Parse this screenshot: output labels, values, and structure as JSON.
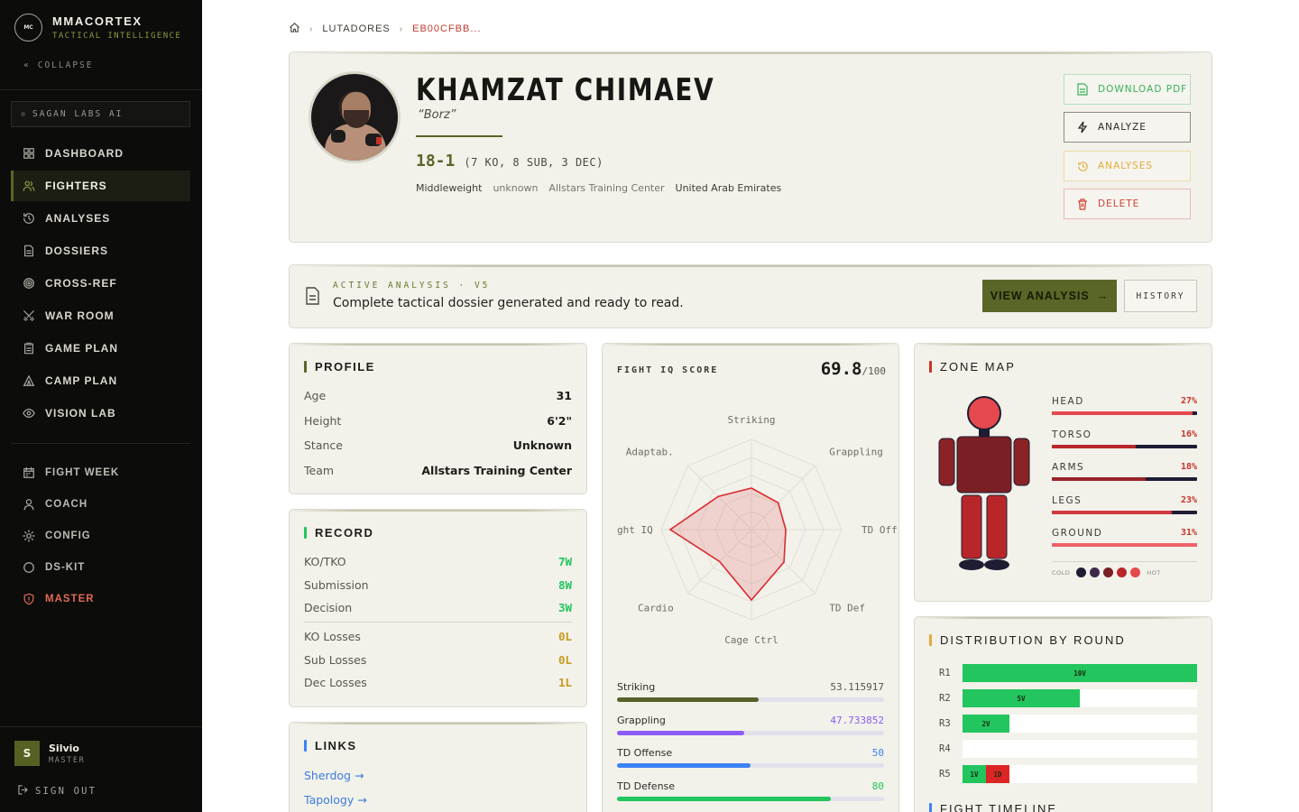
{
  "brand": {
    "logo": "MC",
    "name": "MMACORTEX",
    "tagline": "TACTICAL INTELLIGENCE",
    "collapse": "COLLAPSE"
  },
  "org": {
    "name": "SAGAN LABS AI"
  },
  "nav": [
    {
      "label": "DASHBOARD",
      "icon": "grid-icon"
    },
    {
      "label": "FIGHTERS",
      "icon": "users-icon",
      "active": true
    },
    {
      "label": "ANALYSES",
      "icon": "history-icon"
    },
    {
      "label": "DOSSIERS",
      "icon": "file-icon"
    },
    {
      "label": "CROSS-REF",
      "icon": "target-icon"
    },
    {
      "label": "WAR ROOM",
      "icon": "swords-icon"
    },
    {
      "label": "GAME PLAN",
      "icon": "clipboard-icon"
    },
    {
      "label": "CAMP PLAN",
      "icon": "tent-icon"
    },
    {
      "label": "VISION LAB",
      "icon": "eye-icon"
    }
  ],
  "nav2": [
    {
      "label": "FIGHT WEEK",
      "icon": "calendar-icon"
    },
    {
      "label": "COACH",
      "icon": "user-icon"
    },
    {
      "label": "CONFIG",
      "icon": "gear-icon"
    },
    {
      "label": "DS-KIT",
      "icon": "circle-icon"
    },
    {
      "label": "MASTER",
      "icon": "shield-icon"
    }
  ],
  "user": {
    "initial": "S",
    "name": "Silvio",
    "role": "MASTER",
    "signout": "SIGN OUT"
  },
  "breadcrumb": {
    "section": "LUTADORES",
    "current": "EB00CFBB..."
  },
  "fighter": {
    "name": "KHAMZAT CHIMAEV",
    "nickname": "“Borz”",
    "record": "18-1",
    "record_detail": "(7 KO, 8 SUB, 3 DEC)",
    "weight_class": "Middleweight",
    "extra": "unknown",
    "team": "Allstars Training Center",
    "country": "United Arab Emirates"
  },
  "actions": {
    "download": "DOWNLOAD PDF",
    "analyze": "ANALYZE",
    "analyses": "ANALYSES",
    "delete": "DELETE"
  },
  "analysis": {
    "label": "ACTIVE ANALYSIS · V5",
    "text": "Complete tactical dossier generated and ready to read.",
    "view": "VIEW ANALYSIS",
    "history": "HISTORY"
  },
  "profile": {
    "title": "PROFILE",
    "rows": [
      {
        "label": "Age",
        "value": "31"
      },
      {
        "label": "Height",
        "value": "6'2\""
      },
      {
        "label": "Stance",
        "value": "Unknown"
      },
      {
        "label": "Team",
        "value": "Allstars Training Center"
      }
    ]
  },
  "record_card": {
    "title": "RECORD",
    "wins": [
      {
        "label": "KO/TKO",
        "value": "7W"
      },
      {
        "label": "Submission",
        "value": "8W"
      },
      {
        "label": "Decision",
        "value": "3W"
      }
    ],
    "losses": [
      {
        "label": "KO Losses",
        "value": "0L"
      },
      {
        "label": "Sub Losses",
        "value": "0L"
      },
      {
        "label": "Dec Losses",
        "value": "1L"
      }
    ]
  },
  "links": {
    "title": "LINKS",
    "items": [
      "Sherdog →",
      "Tapology →"
    ]
  },
  "iq": {
    "title": "FIGHT IQ SCORE",
    "score": "69.8",
    "max": "/100",
    "axes": [
      "Striking",
      "Grappling",
      "TD Off",
      "TD Def",
      "Cage Ctrl",
      "Cardio",
      "ght IQ",
      "Adaptab."
    ],
    "radar_values": [
      0.46,
      0.42,
      0.38,
      0.51,
      0.78,
      0.5,
      0.9,
      0.52
    ],
    "bars": [
      {
        "label": "Striking",
        "value": "53.115917",
        "pct": 53.1,
        "color": "#57622a",
        "vcolor": "#55544d"
      },
      {
        "label": "Grappling",
        "value": "47.733852",
        "pct": 47.7,
        "color": "#8b5cf6",
        "vcolor": "#8b5cf6"
      },
      {
        "label": "TD Offense",
        "value": "50",
        "pct": 50,
        "color": "#3b82f6",
        "vcolor": "#3b82f6"
      },
      {
        "label": "TD Defense",
        "value": "80",
        "pct": 80,
        "color": "#22c55e",
        "vcolor": "#22c55e"
      }
    ]
  },
  "zone": {
    "title": "ZONE MAP",
    "rows": [
      {
        "label": "HEAD",
        "pct": "27%",
        "value": 27
      },
      {
        "label": "TORSO",
        "pct": "16%",
        "value": 16
      },
      {
        "label": "ARMS",
        "pct": "18%",
        "value": 18
      },
      {
        "label": "LEGS",
        "pct": "23%",
        "value": 23
      },
      {
        "label": "GROUND",
        "pct": "31%",
        "value": 31
      }
    ],
    "legend": {
      "cold": "COLD",
      "hot": "HOT",
      "colors": [
        "#1e1d33",
        "#3d2a4a",
        "#7a1f24",
        "#b8262a",
        "#e5484d"
      ]
    }
  },
  "distribution": {
    "title": "DISTRIBUTION BY ROUND",
    "rounds": [
      {
        "label": "R1",
        "segs": [
          {
            "text": "10V",
            "pct": 100,
            "color": "#22c55e"
          }
        ]
      },
      {
        "label": "R2",
        "segs": [
          {
            "text": "5V",
            "pct": 50,
            "color": "#22c55e"
          }
        ]
      },
      {
        "label": "R3",
        "segs": [
          {
            "text": "2V",
            "pct": 20,
            "color": "#22c55e"
          }
        ]
      },
      {
        "label": "R4",
        "segs": []
      },
      {
        "label": "R5",
        "segs": [
          {
            "text": "1V",
            "pct": 10,
            "color": "#22c55e"
          },
          {
            "text": "1D",
            "pct": 10,
            "color": "#dc2626"
          }
        ]
      }
    ]
  },
  "timeline": {
    "title": "FIGHT TIMELINE"
  }
}
